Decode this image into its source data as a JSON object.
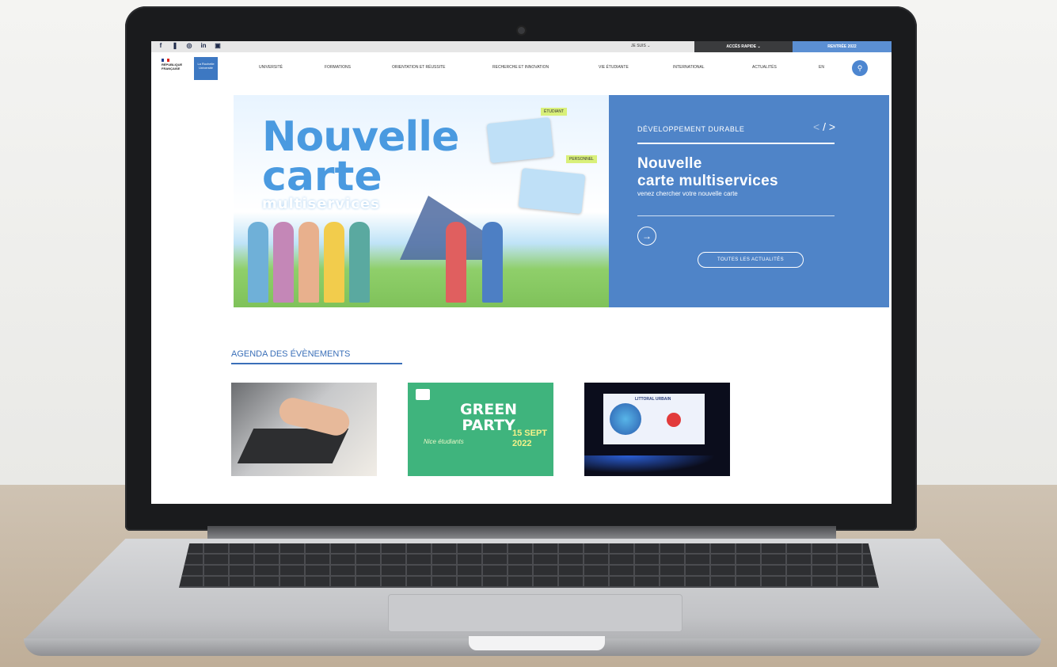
{
  "topbar": {
    "social": [
      "f",
      "❚",
      "◎",
      "in",
      "▣"
    ],
    "je_suis": "JE SUIS ⌄",
    "acces_rapide": "ACCÈS RAPIDE ⌄",
    "rentree": "RENTRÉE 2022"
  },
  "header": {
    "gov_logo_lines": [
      "RÉPUBLIQUE",
      "FRANÇAISE"
    ],
    "univ_logo_lines": [
      "La Rochelle",
      "Université"
    ]
  },
  "nav": {
    "items": [
      "UNIVERSITÉ",
      "FORMATIONS",
      "ORIENTATION ET RÉUSSITE",
      "RECHERCHE ET INNOVATION",
      "VIE ÉTUDIANTE",
      "INTERNATIONAL",
      "ACTUALITÉS",
      "EN"
    ],
    "search_icon": "search-icon"
  },
  "hero": {
    "image_title_l1": "Nouvelle",
    "image_title_l2": "carte",
    "image_title_l3": "multiservices",
    "tag_student": "ÉTUDIANT",
    "tag_staff": "PERSONNEL",
    "category": "DÉVELOPPEMENT DURABLE",
    "title_l1": "Nouvelle",
    "title_l2": "carte multiservices",
    "subtitle": "venez chercher votre nouvelle carte",
    "prev": "<",
    "separator": "/",
    "next": ">",
    "go_arrow": "→",
    "all_news": "TOUTES LES ACTUALITÉS",
    "colors": {
      "panel": "#4f84c8",
      "title_blue": "#4a9ae0"
    }
  },
  "agenda": {
    "title": "AGENDA DES ÉVÈNEMENTS",
    "events": [
      {
        "kind": "laptop-typing-photo"
      },
      {
        "line1": "GREEN",
        "line2": "PARTY",
        "date_l1": "15 SEPT",
        "date_l2": "2022",
        "caption": "Nice étudiants"
      },
      {
        "slide_title": "LITTORAL URBAIN"
      }
    ]
  }
}
